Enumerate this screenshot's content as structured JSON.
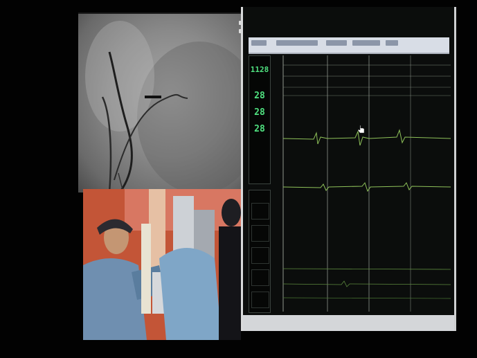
{
  "monitor": {
    "vitals": [
      {
        "label": "",
        "value": "1128",
        "size": "small"
      },
      {
        "label": "",
        "value": "28"
      },
      {
        "label": "",
        "value": "28"
      },
      {
        "label": "",
        "value": "28"
      }
    ],
    "trace_color": "#7ecb4e",
    "frame_color": "#d9dadb"
  },
  "icons": {
    "cursor": "hand-pointer-icon"
  }
}
